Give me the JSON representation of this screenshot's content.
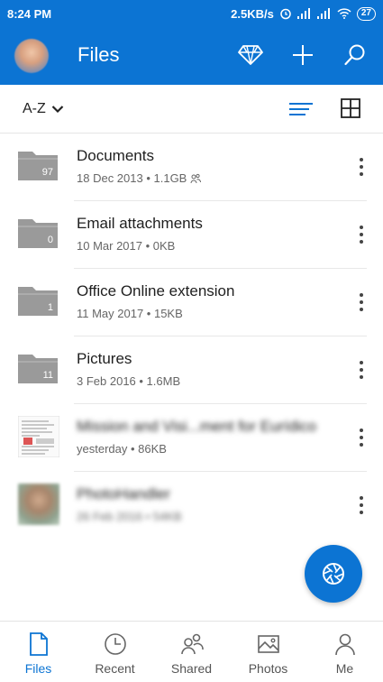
{
  "status_bar": {
    "time": "8:24 PM",
    "network_speed": "2.5KB/s",
    "battery": "27"
  },
  "app_bar": {
    "title": "Files",
    "actions": [
      "premium-diamond-icon",
      "add-icon",
      "search-icon"
    ]
  },
  "toolbar": {
    "sort_label": "A-Z"
  },
  "files": [
    {
      "name": "Documents",
      "meta": "18 Dec 2013 • 1.1GB",
      "type": "folder",
      "count": "97",
      "shared": true
    },
    {
      "name": "Email attachments",
      "meta": "10 Mar 2017 • 0KB",
      "type": "folder",
      "count": "0"
    },
    {
      "name": "Office Online extension",
      "meta": "11 May 2017 • 15KB",
      "type": "folder",
      "count": "1"
    },
    {
      "name": "Pictures",
      "meta": "3 Feb 2016 • 1.6MB",
      "type": "folder",
      "count": "11"
    },
    {
      "name": "Mission and Visi...ment for Eurídico",
      "meta": "yesterday • 86KB",
      "type": "document"
    },
    {
      "name": "PhotoHandler",
      "meta": "26 Feb 2016 • 54KB",
      "type": "photo"
    }
  ],
  "bottom_nav": [
    {
      "label": "Files",
      "icon": "file-icon",
      "active": true
    },
    {
      "label": "Recent",
      "icon": "clock-icon"
    },
    {
      "label": "Shared",
      "icon": "people-icon"
    },
    {
      "label": "Photos",
      "icon": "image-icon"
    },
    {
      "label": "Me",
      "icon": "person-icon"
    }
  ],
  "colors": {
    "primary": "#0c74d3",
    "folder": "#9a9a9a"
  }
}
